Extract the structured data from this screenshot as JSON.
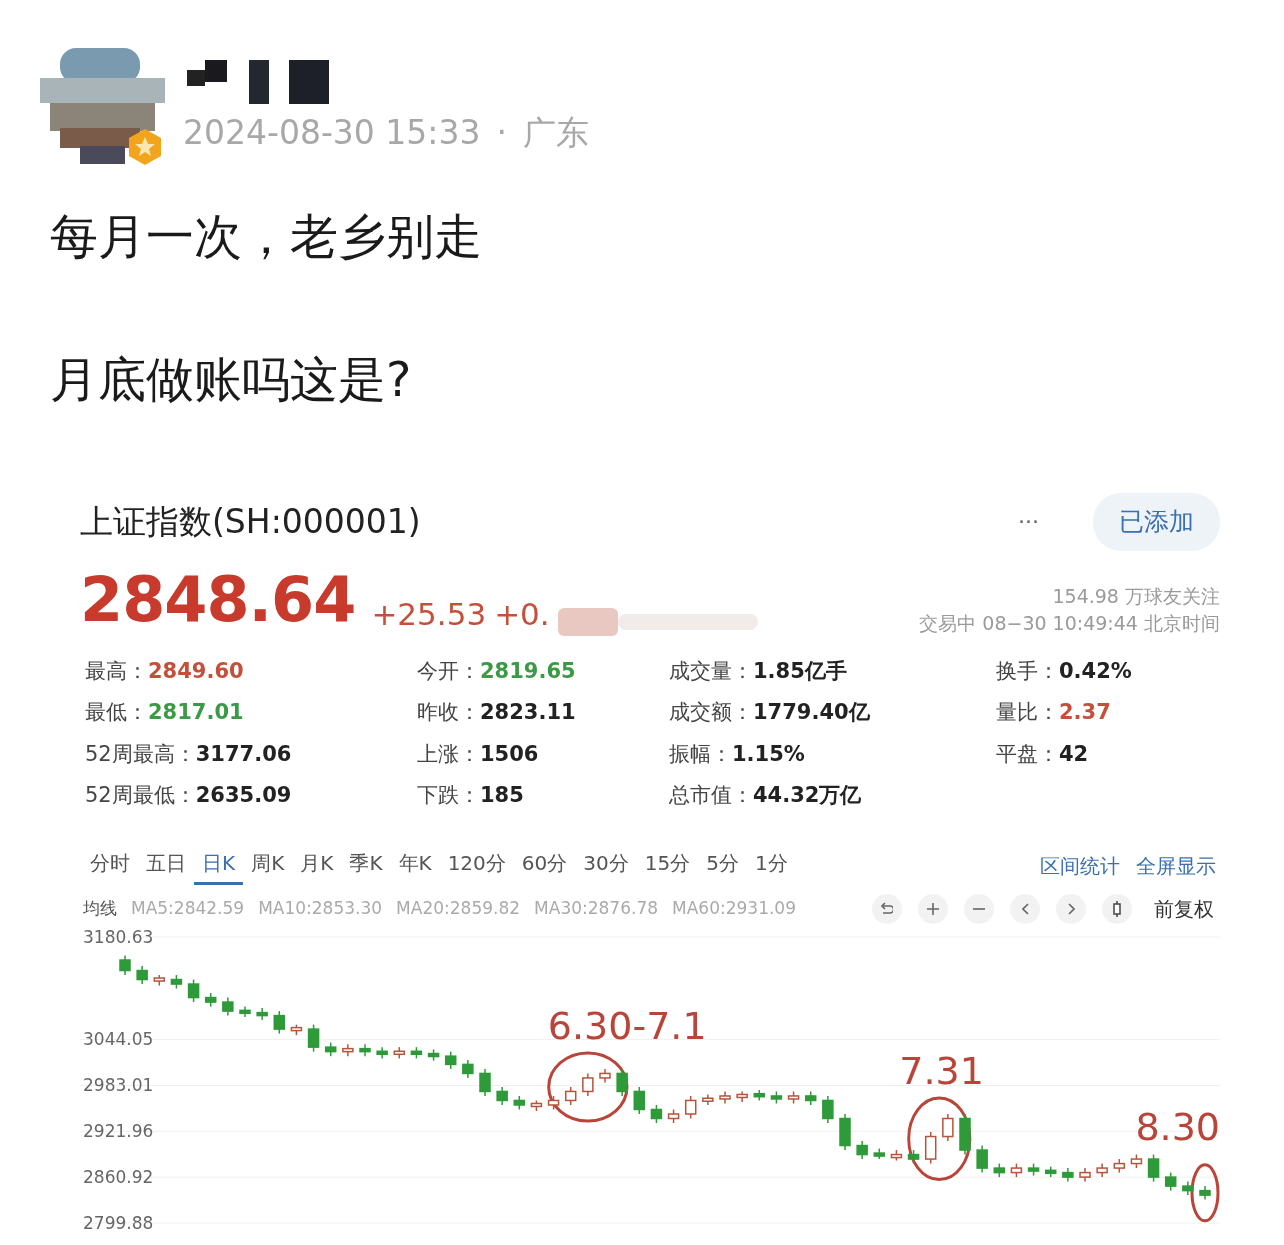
{
  "post": {
    "timestamp": "2024-08-30 15:33",
    "separator": "·",
    "location": "广东",
    "paragraphs": [
      "每月一次，老乡别走",
      "月底做账吗这是?"
    ]
  },
  "stock": {
    "title": "上证指数(SH:000001)",
    "more": "···",
    "add_button": "已添加",
    "price": "2848.64",
    "change": "+25.53",
    "change_pct": "+0.",
    "followers": "154.98 万球友关注",
    "status": "交易中 08−30 10:49:44 北京时间",
    "stats": [
      {
        "label": "最高：",
        "value": "2849.60",
        "color": "#c4503c"
      },
      {
        "label": "今开：",
        "value": "2819.65",
        "color": "#3b9a45"
      },
      {
        "label": "成交量：",
        "value": "1.85亿手",
        "color": "#222222"
      },
      {
        "label": "换手：",
        "value": "0.42%",
        "color": "#222222"
      },
      {
        "label": "最低：",
        "value": "2817.01",
        "color": "#3b9a45"
      },
      {
        "label": "昨收：",
        "value": "2823.11",
        "color": "#222222"
      },
      {
        "label": "成交额：",
        "value": "1779.40亿",
        "color": "#222222"
      },
      {
        "label": "量比：",
        "value": "2.37",
        "color": "#c4503c"
      },
      {
        "label": "52周最高：",
        "value": "3177.06",
        "color": "#222222"
      },
      {
        "label": "上涨：",
        "value": "1506",
        "color": "#222222"
      },
      {
        "label": "振幅：",
        "value": "1.15%",
        "color": "#222222"
      },
      {
        "label": "平盘：",
        "value": "42",
        "color": "#222222"
      },
      {
        "label": "52周最低：",
        "value": "2635.09",
        "color": "#222222"
      },
      {
        "label": "下跌：",
        "value": "185",
        "color": "#222222"
      },
      {
        "label": "总市值：",
        "value": "44.32万亿",
        "color": "#222222"
      }
    ],
    "periods": [
      {
        "label": "分时",
        "selected": false
      },
      {
        "label": "五日",
        "selected": false
      },
      {
        "label": "日K",
        "selected": true
      },
      {
        "label": "周K",
        "selected": false
      },
      {
        "label": "月K",
        "selected": false
      },
      {
        "label": "季K",
        "selected": false
      },
      {
        "label": "年K",
        "selected": false
      },
      {
        "label": "120分",
        "selected": false
      },
      {
        "label": "60分",
        "selected": false
      },
      {
        "label": "30分",
        "selected": false
      },
      {
        "label": "15分",
        "selected": false
      },
      {
        "label": "5分",
        "selected": false
      },
      {
        "label": "1分",
        "selected": false
      }
    ],
    "range_stats": "区间统计",
    "fullscreen": "全屏显示",
    "ma_label": "均线",
    "ma_values": [
      "MA5:2842.59",
      "MA10:2853.30",
      "MA20:2859.82",
      "MA30:2876.78",
      "MA60:2931.09"
    ],
    "adjust": "前复权",
    "chart_data": {
      "type": "candlestick",
      "grid": true,
      "ohlc": [
        [
          3150,
          3156,
          3130,
          3136
        ],
        [
          3136,
          3142,
          3118,
          3124
        ],
        [
          3122,
          3130,
          3116,
          3126
        ],
        [
          3124,
          3130,
          3112,
          3118
        ],
        [
          3118,
          3124,
          3094,
          3100
        ],
        [
          3100,
          3106,
          3088,
          3094
        ],
        [
          3094,
          3100,
          3076,
          3082
        ],
        [
          3082,
          3088,
          3074,
          3080
        ],
        [
          3080,
          3086,
          3070,
          3076
        ],
        [
          3076,
          3082,
          3052,
          3058
        ],
        [
          3056,
          3064,
          3050,
          3060
        ],
        [
          3058,
          3064,
          3028,
          3034
        ],
        [
          3034,
          3040,
          3022,
          3028
        ],
        [
          3028,
          3038,
          3022,
          3032
        ],
        [
          3032,
          3038,
          3022,
          3028
        ],
        [
          3028,
          3034,
          3019,
          3025
        ],
        [
          3025,
          3034,
          3019,
          3028
        ],
        [
          3028,
          3034,
          3019,
          3025
        ],
        [
          3025,
          3031,
          3016,
          3022
        ],
        [
          3022,
          3028,
          3005,
          3011
        ],
        [
          3011,
          3017,
          2993,
          2999
        ],
        [
          2999,
          3005,
          2969,
          2975
        ],
        [
          2975,
          2981,
          2957,
          2963
        ],
        [
          2963,
          2969,
          2951,
          2957
        ],
        [
          2955,
          2963,
          2949,
          2959
        ],
        [
          2957,
          2969,
          2951,
          2963
        ],
        [
          2963,
          2981,
          2957,
          2975
        ],
        [
          2975,
          2999,
          2969,
          2993
        ],
        [
          2993,
          3005,
          2987,
          2999
        ],
        [
          2999,
          3005,
          2969,
          2975
        ],
        [
          2975,
          2981,
          2945,
          2951
        ],
        [
          2951,
          2957,
          2933,
          2939
        ],
        [
          2939,
          2951,
          2933,
          2945
        ],
        [
          2945,
          2969,
          2939,
          2963
        ],
        [
          2963,
          2971,
          2957,
          2965
        ],
        [
          2965,
          2975,
          2959,
          2969
        ],
        [
          2967,
          2975,
          2961,
          2971
        ],
        [
          2971,
          2977,
          2963,
          2969
        ],
        [
          2969,
          2975,
          2959,
          2965
        ],
        [
          2965,
          2975,
          2959,
          2969
        ],
        [
          2969,
          2975,
          2957,
          2963
        ],
        [
          2963,
          2969,
          2933,
          2939
        ],
        [
          2939,
          2945,
          2897,
          2903
        ],
        [
          2903,
          2909,
          2885,
          2891
        ],
        [
          2893,
          2899,
          2885,
          2889
        ],
        [
          2887,
          2897,
          2883,
          2891
        ],
        [
          2891,
          2897,
          2879,
          2885
        ],
        [
          2885,
          2921,
          2879,
          2915
        ],
        [
          2915,
          2945,
          2909,
          2939
        ],
        [
          2939,
          2945,
          2891,
          2897
        ],
        [
          2897,
          2903,
          2867,
          2873
        ],
        [
          2873,
          2879,
          2861,
          2867
        ],
        [
          2867,
          2879,
          2861,
          2873
        ],
        [
          2873,
          2879,
          2863,
          2869
        ],
        [
          2869,
          2875,
          2861,
          2867
        ],
        [
          2867,
          2873,
          2855,
          2861
        ],
        [
          2861,
          2873,
          2855,
          2867
        ],
        [
          2867,
          2879,
          2861,
          2873
        ],
        [
          2873,
          2885,
          2867,
          2879
        ],
        [
          2879,
          2891,
          2873,
          2885
        ],
        [
          2885,
          2891,
          2855,
          2861
        ],
        [
          2861,
          2867,
          2843,
          2849
        ],
        [
          2849,
          2855,
          2837,
          2843
        ],
        [
          2843,
          2849,
          2831,
          2837
        ]
      ],
      "ylim": [
        2799.88,
        3180.63
      ],
      "yticks": [
        3180.63,
        3044.05,
        2983.01,
        2921.96,
        2860.92,
        2799.88
      ],
      "annotations": [
        "6.30-7.1",
        "7.31",
        "8.30"
      ]
    }
  }
}
